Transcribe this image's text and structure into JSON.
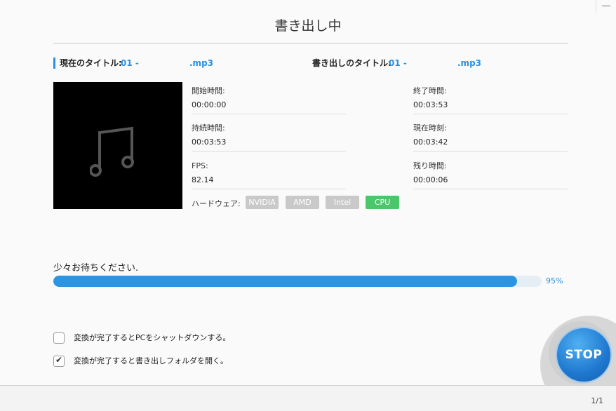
{
  "title": "書き出し中",
  "current": {
    "label": "現在のタイトル:",
    "prefix": "01 -",
    "ext": ".mp3"
  },
  "output": {
    "label": "書き出しのタイトル:",
    "prefix": "01 -",
    "ext": ".mp3"
  },
  "art": {
    "icon": "music-note-icon"
  },
  "fields": {
    "start": {
      "label": "開始時間:",
      "value": "00:00:00"
    },
    "end": {
      "label": "終了時間:",
      "value": "00:03:53"
    },
    "duration": {
      "label": "持続時間:",
      "value": "00:03:53"
    },
    "now": {
      "label": "現在時刻:",
      "value": "00:03:42"
    },
    "fps": {
      "label": "FPS:",
      "value": "82.14"
    },
    "remaining": {
      "label": "残り時間:",
      "value": "00:00:06"
    }
  },
  "hardware": {
    "label": "ハードウェア:",
    "options": [
      {
        "label": "NVIDIA",
        "active": false
      },
      {
        "label": "AMD",
        "active": false
      },
      {
        "label": "Intel",
        "active": false
      },
      {
        "label": "CPU",
        "active": true
      }
    ]
  },
  "progress": {
    "message": "少々お待ちください.",
    "percent": 95,
    "percent_label": "95%"
  },
  "options": {
    "shutdown": {
      "label": "変換が完了するとPCをシャットダウンする。",
      "checked": false
    },
    "open_folder": {
      "label": "変換が完了すると書き出しフォルダを開く。",
      "checked": true
    }
  },
  "stop_label": "STOP",
  "pager": "1/1",
  "colors": {
    "accent": "#2a8fe0",
    "active_chip": "#4cc66b",
    "inactive_chip": "#c9c9c9"
  }
}
